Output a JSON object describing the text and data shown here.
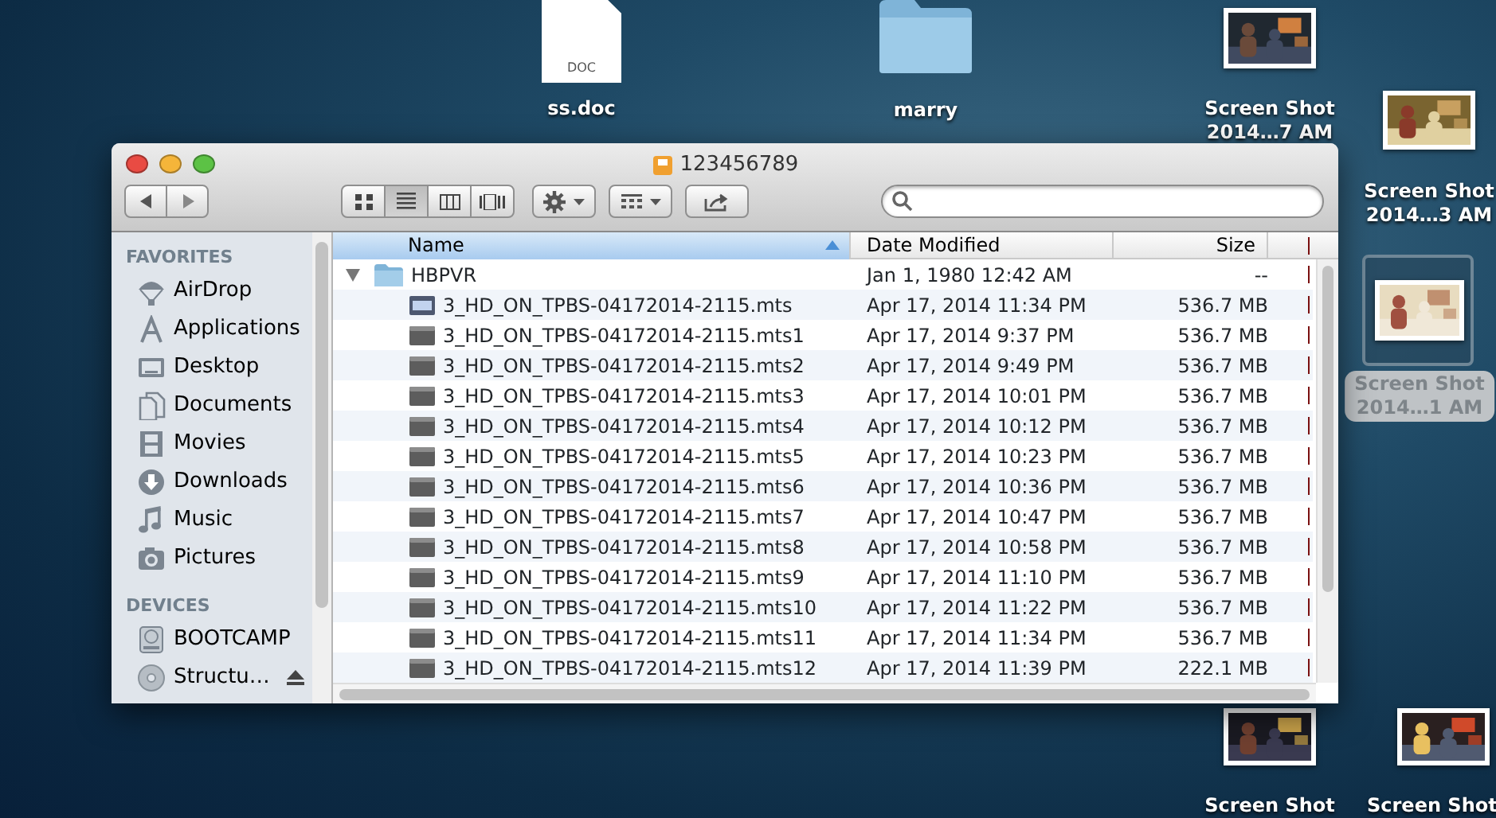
{
  "desktop_icons": [
    {
      "kind": "document",
      "badge": "DOC",
      "lines": [
        "ss.doc"
      ],
      "selected": false
    },
    {
      "kind": "folder",
      "lines": [
        "marry"
      ],
      "selected": false
    },
    {
      "kind": "screenshot",
      "lines": [
        "Screen Shot",
        "2014…7 AM"
      ],
      "selected": false
    },
    {
      "kind": "screenshot",
      "lines": [
        "Screen Shot",
        "2014…3 AM"
      ],
      "selected": false
    },
    {
      "kind": "screenshot",
      "lines": [
        "Screen Shot",
        "2014…1 AM"
      ],
      "selected": true
    },
    {
      "kind": "screenshot",
      "lines": [
        "Screen Shot"
      ],
      "selected": false
    },
    {
      "kind": "screenshot",
      "lines": [
        "Screen Shot"
      ],
      "selected": false
    }
  ],
  "window": {
    "title": "123456789",
    "view_modes": [
      {
        "kind": "icons",
        "selected": false
      },
      {
        "kind": "list",
        "selected": true
      },
      {
        "kind": "columns",
        "selected": false
      },
      {
        "kind": "cover-flow",
        "selected": false
      }
    ],
    "sidebar": [
      {
        "heading": "FAVORITES",
        "items": [
          {
            "kind": "airdrop",
            "label": "AirDrop"
          },
          {
            "kind": "applications",
            "label": "Applications"
          },
          {
            "kind": "desktop",
            "label": "Desktop"
          },
          {
            "kind": "documents",
            "label": "Documents"
          },
          {
            "kind": "movies",
            "label": "Movies"
          },
          {
            "kind": "downloads",
            "label": "Downloads"
          },
          {
            "kind": "music",
            "label": "Music"
          },
          {
            "kind": "pictures",
            "label": "Pictures"
          }
        ]
      },
      {
        "heading": "DEVICES",
        "items": [
          {
            "kind": "drive",
            "label": "BOOTCAMP",
            "ejectable": false
          },
          {
            "kind": "disc",
            "label": "Structu…",
            "ejectable": true
          }
        ]
      }
    ],
    "columns": [
      {
        "label": "Name",
        "selected": true
      },
      {
        "label": "Date Modified",
        "selected": false
      },
      {
        "label": "Size",
        "selected": false
      }
    ],
    "rows": [
      {
        "kind": "folder",
        "name": "HBPVR",
        "date": "Jan 1, 1980 12:42 AM",
        "size": "--",
        "expanded": true,
        "children": [
          {
            "kind": "movie",
            "name": "3_HD_ON_TPBS-04172014-2115.mts",
            "date": "Apr 17, 2014 11:34 PM",
            "size": "536.7 MB"
          },
          {
            "kind": "file",
            "name": "3_HD_ON_TPBS-04172014-2115.mts1",
            "date": "Apr 17, 2014 9:37 PM",
            "size": "536.7 MB"
          },
          {
            "kind": "file",
            "name": "3_HD_ON_TPBS-04172014-2115.mts2",
            "date": "Apr 17, 2014 9:49 PM",
            "size": "536.7 MB"
          },
          {
            "kind": "file",
            "name": "3_HD_ON_TPBS-04172014-2115.mts3",
            "date": "Apr 17, 2014 10:01 PM",
            "size": "536.7 MB"
          },
          {
            "kind": "file",
            "name": "3_HD_ON_TPBS-04172014-2115.mts4",
            "date": "Apr 17, 2014 10:12 PM",
            "size": "536.7 MB"
          },
          {
            "kind": "file",
            "name": "3_HD_ON_TPBS-04172014-2115.mts5",
            "date": "Apr 17, 2014 10:23 PM",
            "size": "536.7 MB"
          },
          {
            "kind": "file",
            "name": "3_HD_ON_TPBS-04172014-2115.mts6",
            "date": "Apr 17, 2014 10:36 PM",
            "size": "536.7 MB"
          },
          {
            "kind": "file",
            "name": "3_HD_ON_TPBS-04172014-2115.mts7",
            "date": "Apr 17, 2014 10:47 PM",
            "size": "536.7 MB"
          },
          {
            "kind": "file",
            "name": "3_HD_ON_TPBS-04172014-2115.mts8",
            "date": "Apr 17, 2014 10:58 PM",
            "size": "536.7 MB"
          },
          {
            "kind": "file",
            "name": "3_HD_ON_TPBS-04172014-2115.mts9",
            "date": "Apr 17, 2014 11:10 PM",
            "size": "536.7 MB"
          },
          {
            "kind": "file",
            "name": "3_HD_ON_TPBS-04172014-2115.mts10",
            "date": "Apr 17, 2014 11:22 PM",
            "size": "536.7 MB"
          },
          {
            "kind": "file",
            "name": "3_HD_ON_TPBS-04172014-2115.mts11",
            "date": "Apr 17, 2014 11:34 PM",
            "size": "536.7 MB"
          },
          {
            "kind": "file",
            "name": "3_HD_ON_TPBS-04172014-2115.mts12",
            "date": "Apr 17, 2014 11:39 PM",
            "size": "222.1 MB"
          }
        ]
      }
    ]
  }
}
